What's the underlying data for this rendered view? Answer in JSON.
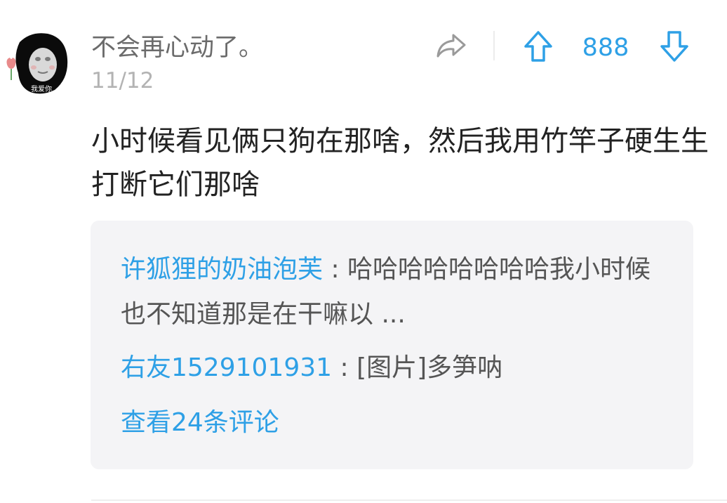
{
  "comment": {
    "author": "不会再心动了。",
    "date": "11/12",
    "avatar_caption": "我爱你",
    "text": "小时候看见俩只狗在那啥，然后我用竹竿子硬生生打断它们那啥",
    "vote_count": "888"
  },
  "icons": {
    "share": "share-arrow-icon",
    "upvote": "arrow-up-icon",
    "downvote": "arrow-down-icon"
  },
  "colors": {
    "accent": "#2ea0e6",
    "author": "#6b6b6b",
    "date": "#b3b3b3",
    "text": "#222222",
    "reply_bg": "#f4f4f6"
  },
  "replies": [
    {
      "name": "许狐狸的奶油泡芙",
      "separator": " : ",
      "text": "哈哈哈哈哈哈哈哈我小时候也不知道那是在干嘛以 ..."
    },
    {
      "name": "右友1529101931",
      "separator": " : ",
      "text": "[图片]多笋呐"
    }
  ],
  "more_replies_label": "查看24条评论"
}
